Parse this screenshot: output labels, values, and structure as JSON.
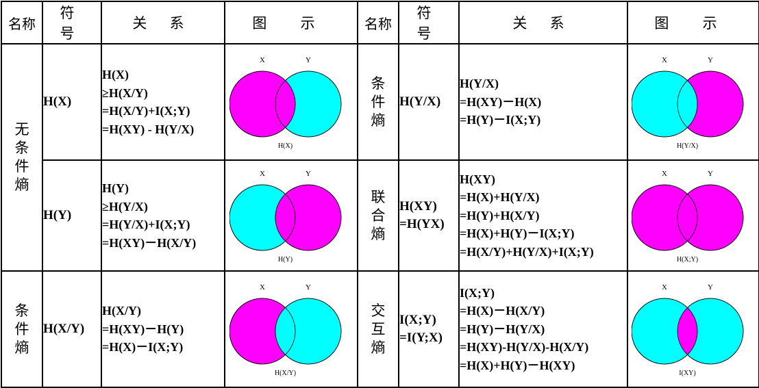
{
  "headers": {
    "name": "名称",
    "symbol": "符 号",
    "relation": "关 系",
    "figure": "图 示"
  },
  "colors": {
    "magenta": "#ff00ff",
    "cyan": "#00ffff"
  },
  "left": [
    {
      "symbol": "H(X)",
      "relation": [
        "H(X)",
        "≥H(X/Y)",
        "=H(X/Y)+I(X;Y)",
        "=H(XY) - H(Y/X)"
      ],
      "figure": {
        "label_x": "X",
        "label_y": "Y",
        "caption": "H(X)",
        "left_color": "magenta",
        "right_color": "cyan",
        "intersection": "magenta",
        "top": "left"
      }
    },
    {
      "symbol": "H(Y)",
      "relation": [
        "H(Y)",
        "≥H(Y/X)",
        "=H(Y/X)+I(X;Y)",
        "=H(XY)－H(X/Y)"
      ],
      "figure": {
        "label_x": "X",
        "label_y": "Y",
        "caption": "H(Y)",
        "left_color": "cyan",
        "right_color": "magenta",
        "intersection": "magenta",
        "top": "right"
      }
    },
    {
      "symbol": "H(X/Y)",
      "relation": [
        "H(X/Y)",
        "=H(XY)－H(Y)",
        "=H(X)－I(X;Y)"
      ],
      "figure": {
        "label_x": "X",
        "label_y": "Y",
        "caption": "H(X/Y)",
        "left_color": "magenta",
        "right_color": "cyan",
        "intersection": "cyan",
        "top": "right"
      }
    }
  ],
  "left_names": [
    {
      "chars": [
        "无",
        "条",
        "件",
        "熵"
      ]
    },
    {
      "chars": [
        "条",
        "件",
        "熵"
      ]
    }
  ],
  "right": [
    {
      "name_chars": [
        "条",
        "件",
        "熵"
      ],
      "symbol_lines": [
        "H(Y/X)"
      ],
      "relation": [
        "H(Y/X)",
        "=H(XY)－H(X)",
        "=H(Y)－I(X;Y)"
      ],
      "figure": {
        "label_x": "X",
        "label_y": "Y",
        "caption": "H(Y/X)",
        "left_color": "cyan",
        "right_color": "magenta",
        "intersection": "cyan",
        "top": "left"
      }
    },
    {
      "name_chars": [
        "联",
        "合",
        "熵"
      ],
      "symbol_lines": [
        "H(XY)",
        "=H(YX)"
      ],
      "relation": [
        "H(XY)",
        "=H(X)+H(Y/X)",
        "=H(Y)+H(X/Y)",
        "=H(X)+H(Y)－I(X;Y)",
        "=H(X/Y)+H(Y/X)+I(X;Y)"
      ],
      "figure": {
        "label_x": "X",
        "label_y": "Y",
        "caption": "H(X;Y)",
        "left_color": "magenta",
        "right_color": "magenta",
        "intersection": "magenta",
        "top": "left"
      }
    },
    {
      "name_chars": [
        "交",
        "互",
        "熵"
      ],
      "symbol_lines": [
        "I(X;Y)",
        "=I(Y;X)"
      ],
      "relation": [
        "I(X;Y)",
        "=H(X)－H(X/Y)",
        "=H(Y)－H(Y/X)",
        "=H(XY)-H(Y/X)-H(X/Y)",
        "=H(X)+H(Y)－H(XY)"
      ],
      "figure": {
        "label_x": "X",
        "label_y": "Y",
        "caption": "I(XY)",
        "left_color": "cyan",
        "right_color": "cyan",
        "intersection": "magenta",
        "top": "left"
      }
    }
  ]
}
